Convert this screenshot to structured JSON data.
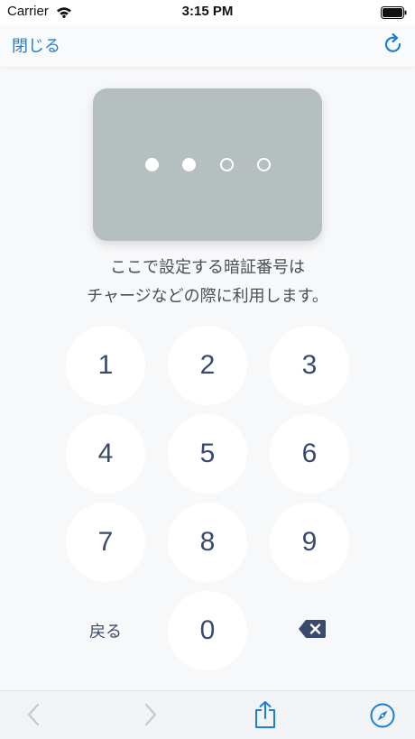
{
  "status_bar": {
    "carrier": "Carrier",
    "time": "3:15 PM"
  },
  "nav": {
    "close_label": "閉じる",
    "reload_icon": "reload-icon"
  },
  "pin": {
    "length": 4,
    "entered": 2
  },
  "instructions": {
    "line1": "ここで設定する暗証番号は",
    "line2": "チャージなどの際に利用します。"
  },
  "keypad": {
    "keys": [
      "1",
      "2",
      "3",
      "4",
      "5",
      "6",
      "7",
      "8",
      "9",
      "0"
    ],
    "back_label": "戻る",
    "delete_icon": "backspace-icon"
  },
  "toolbar": {
    "icons": [
      "back-arrow-icon",
      "forward-arrow-icon",
      "share-icon",
      "compass-icon"
    ]
  },
  "colors": {
    "accent": "#1a7fd6",
    "card": "#b5bfc0",
    "key_text": "#3a4a6e",
    "background": "#f7f8f9"
  }
}
